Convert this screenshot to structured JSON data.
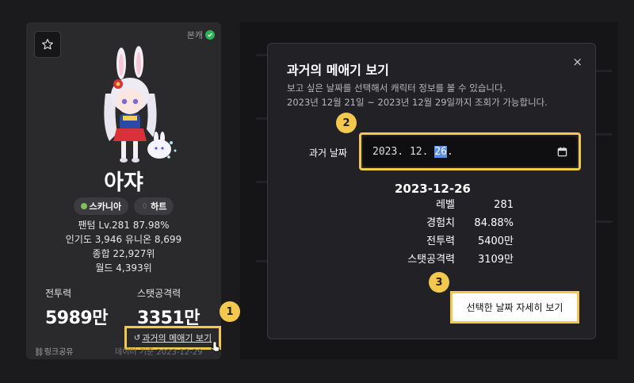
{
  "card": {
    "main_badge": "본캐",
    "name": "아쟈",
    "tags": [
      "스카니아",
      "하트"
    ],
    "job_line": "팬텀 Lv.281 87.98%",
    "pop_line": "인기도 3,946 유니온 8,699",
    "overall_rank": "종합 22,927위",
    "world_rank": "월드 4,393위",
    "stats": [
      {
        "label": "전투력",
        "value": "5989만"
      },
      {
        "label": "스탯공격력",
        "value": "3351만"
      }
    ],
    "past_link": "과거의 메애기 보기",
    "share": "링크공유",
    "date_ref": "데이터 기준 2023-12-29"
  },
  "steps": [
    "1",
    "2",
    "3"
  ],
  "modal": {
    "title": "과거의 메애기 보기",
    "desc1": "보고 싶은 날짜를 선택해서 캐릭터 정보를 볼 수 있습니다.",
    "desc2": "2023년 12월 21일 ~ 2023년 12월 29일까지 조회가 가능합니다.",
    "field_label": "과거 날짜",
    "date_prefix": "2023. 12. ",
    "date_day": "26",
    "date_suffix": ".",
    "result_date": "2023-12-26",
    "rows": [
      {
        "k": "레벨",
        "v": "281"
      },
      {
        "k": "경험치",
        "v": "84.88%"
      },
      {
        "k": "전투력",
        "v": "5400만"
      },
      {
        "k": "스탯공격력",
        "v": "3109만"
      }
    ],
    "detail_button": "선택한 날짜 자세히 보기",
    "close": "×"
  },
  "colors": {
    "highlight": "#f2c94c",
    "verified": "#2fb35a"
  },
  "icons": [
    "star-icon",
    "check-icon",
    "history-icon",
    "link-icon",
    "calendar-icon",
    "close-icon",
    "cursor-icon"
  ]
}
